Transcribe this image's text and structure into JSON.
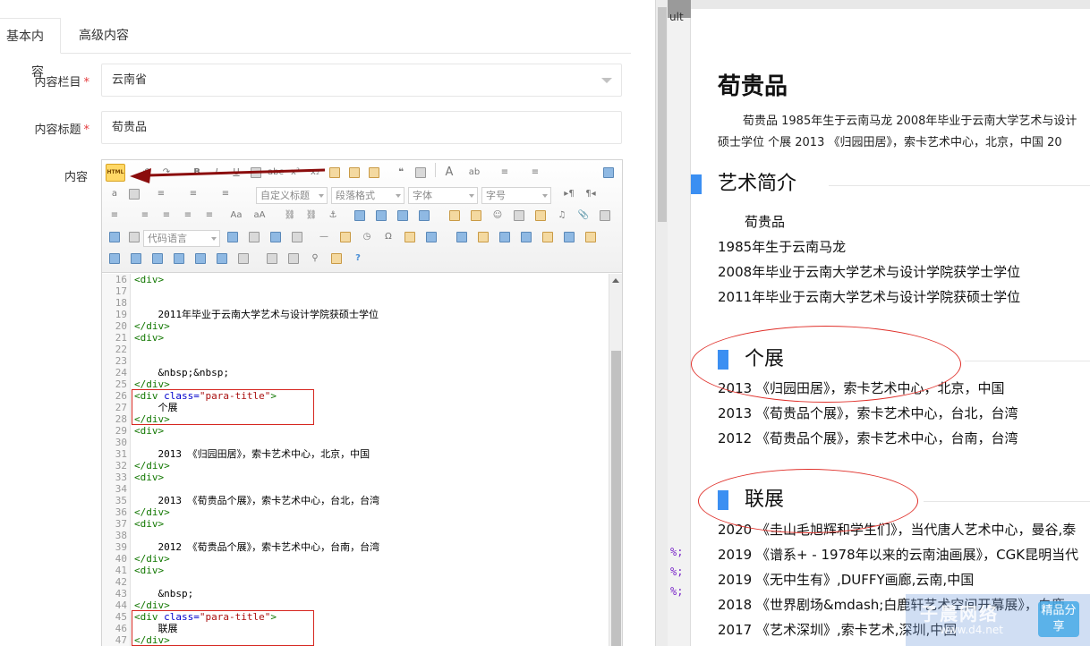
{
  "tabs": {
    "basic": "基本内容",
    "advanced": "高级内容"
  },
  "form": {
    "category_label": "内容栏目",
    "category_value": "云南省",
    "title_label": "内容标题",
    "title_value": "荀贵品",
    "content_label": "内容",
    "required_mark": "*"
  },
  "toolbar": {
    "html_button": "HTML",
    "custom_title": "自定义标题",
    "paragraph_format": "段落格式",
    "font_family": "字体",
    "font_size": "字号",
    "code_language": "代码语言"
  },
  "code_lines": [
    {
      "n": "16",
      "text": "<div>"
    },
    {
      "n": "17",
      "text": ""
    },
    {
      "n": "18",
      "text": ""
    },
    {
      "n": "19",
      "text": "    2011年毕业于云南大学艺术与设计学院获硕士学位"
    },
    {
      "n": "20",
      "text": "</div>"
    },
    {
      "n": "21",
      "text": "<div>"
    },
    {
      "n": "22",
      "text": ""
    },
    {
      "n": "23",
      "text": ""
    },
    {
      "n": "24",
      "text": "    &nbsp;&nbsp;"
    },
    {
      "n": "25",
      "text": "</div>"
    },
    {
      "n": "26",
      "text": "<div class=\"para-title\">"
    },
    {
      "n": "27",
      "text": "    个展"
    },
    {
      "n": "28",
      "text": "</div>"
    },
    {
      "n": "29",
      "text": "<div>"
    },
    {
      "n": "30",
      "text": ""
    },
    {
      "n": "31",
      "text": "    2013 《归园田居》，索卡艺术中心，北京，中国"
    },
    {
      "n": "32",
      "text": "</div>"
    },
    {
      "n": "33",
      "text": "<div>"
    },
    {
      "n": "34",
      "text": ""
    },
    {
      "n": "35",
      "text": "    2013 《荀贵品个展》，索卡艺术中心，台北，台湾"
    },
    {
      "n": "36",
      "text": "</div>"
    },
    {
      "n": "37",
      "text": "<div>"
    },
    {
      "n": "38",
      "text": ""
    },
    {
      "n": "39",
      "text": "    2012 《荀贵品个展》，索卡艺术中心，台南，台湾"
    },
    {
      "n": "40",
      "text": "</div>"
    },
    {
      "n": "41",
      "text": "<div>"
    },
    {
      "n": "42",
      "text": ""
    },
    {
      "n": "43",
      "text": "    &nbsp;"
    },
    {
      "n": "44",
      "text": "</div>"
    },
    {
      "n": "45",
      "text": "<div class=\"para-title\">"
    },
    {
      "n": "46",
      "text": "    联展"
    },
    {
      "n": "47",
      "text": "</div>"
    }
  ],
  "side_strip": {
    "top_text": "ult",
    "marks": [
      "%;",
      "%;",
      "%;"
    ]
  },
  "preview": {
    "title": "荀贵品",
    "intro_line1": "荀贵品 1985年生于云南马龙 2008年毕业于云南大学艺术与设计",
    "intro_line2": "硕士学位 个展 2013 《归园田居》，索卡艺术中心，北京，中国 20",
    "section_bio": "艺术简介",
    "bio_lines": [
      "　　荀贵品",
      "1985年生于云南马龙",
      "2008年毕业于云南大学艺术与设计学院获学士学位",
      "2011年毕业于云南大学艺术与设计学院获硕士学位"
    ],
    "section_solo": "个展",
    "solo_lines": [
      "2013 《归园田居》，索卡艺术中心，北京，中国",
      "2013 《荀贵品个展》，索卡艺术中心，台北，台湾",
      "2012 《荀贵品个展》，索卡艺术中心，台南，台湾"
    ],
    "section_group": "联展",
    "group_lines": [
      "2020 《圭山毛旭辉和学生们》，当代唐人艺术中心，曼谷,泰",
      "2019 《谱系+ - 1978年以来的云南油画展》，CGK昆明当代",
      "2019 《无中生有》,DUFFY画廊,云南,中国",
      "2018 《世界剧场&mdash;白鹿轩艺术空间开幕展》，白鹿",
      "2017 《艺术深圳》,索卡艺术,深圳,中国"
    ]
  },
  "watermark": {
    "text": "子晨网络",
    "sub": "www.d4.net",
    "badge": "精品分享"
  },
  "colors": {
    "accent": "#3b8ff2",
    "annotation": "#e0312b",
    "required": "#e4393c"
  }
}
